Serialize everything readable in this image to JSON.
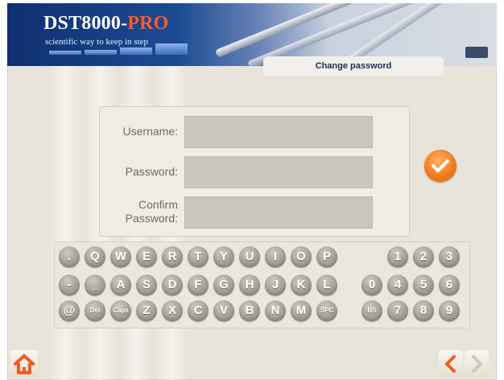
{
  "header": {
    "brand_main": "DST8000-",
    "brand_accent": "PRO",
    "slogan": "scientific way to keep in step",
    "screen_title": "Change password"
  },
  "form": {
    "username_label": "Username:",
    "password_label": "Password:",
    "confirm_label_line1": "Confirm",
    "confirm_label_line2": "Password:",
    "username_value": "",
    "password_value": "",
    "confirm_value": ""
  },
  "keyboard": {
    "rows": [
      [
        ".",
        "Q",
        "W",
        "E",
        "R",
        "T",
        "Y",
        "U",
        "I",
        "O",
        "P",
        "1",
        "2",
        "3"
      ],
      [
        "-",
        "_",
        "A",
        "S",
        "D",
        "F",
        "G",
        "H",
        "J",
        "K",
        "L",
        "0",
        "4",
        "5",
        "6"
      ],
      [
        "@",
        "Del",
        "Caps",
        "Z",
        "X",
        "C",
        "V",
        "B",
        "N",
        "M",
        "SPC",
        "BS",
        "7",
        "8",
        "9"
      ]
    ]
  },
  "icons": {
    "ok": "checkmark-icon",
    "home": "home-icon",
    "back": "chevron-left-icon",
    "forward": "chevron-right-icon"
  },
  "colors": {
    "accent": "#ef7a1c",
    "brand_blue": "#1c4b93",
    "nav_orange": "#f05a28"
  }
}
